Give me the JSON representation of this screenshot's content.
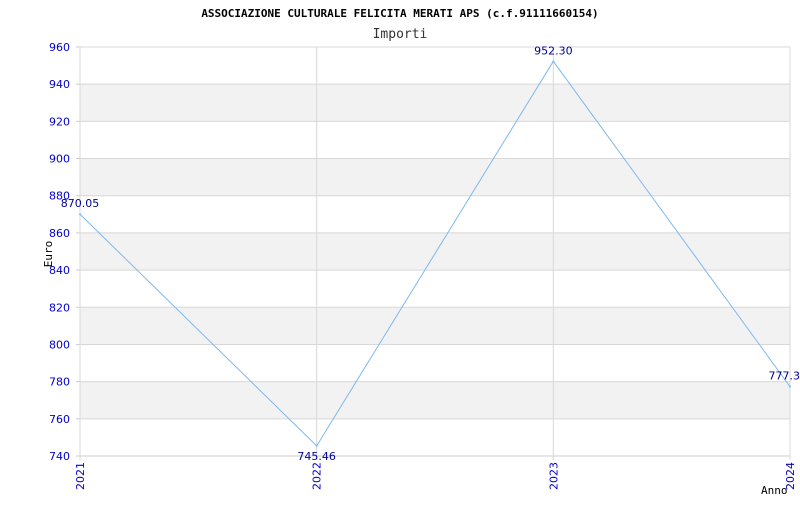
{
  "title": "ASSOCIAZIONE CULTURALE FELICITA MERATI APS (c.f.91111660154)",
  "colors": {
    "line": "#7eb8ee",
    "tick_text": "#0000cc",
    "data_label": "#000099",
    "band": "#f2f2f2",
    "grid": "#d8d8d8",
    "axis": "#cccccc"
  },
  "chart_data": {
    "type": "line",
    "title": "Importi",
    "xlabel": "Anno",
    "ylabel": "Euro",
    "categories": [
      "2021",
      "2022",
      "2023",
      "2024"
    ],
    "series": [
      {
        "values": [
          870.05,
          745.46,
          952.3,
          777.3
        ]
      }
    ],
    "data_labels": [
      "870.05",
      "745.46",
      "952.30",
      "777.3"
    ],
    "ylim": [
      740,
      960
    ],
    "yticks": [
      740,
      760,
      780,
      800,
      820,
      840,
      860,
      880,
      900,
      920,
      940,
      960
    ],
    "grid": true,
    "alternating_bands": true
  }
}
